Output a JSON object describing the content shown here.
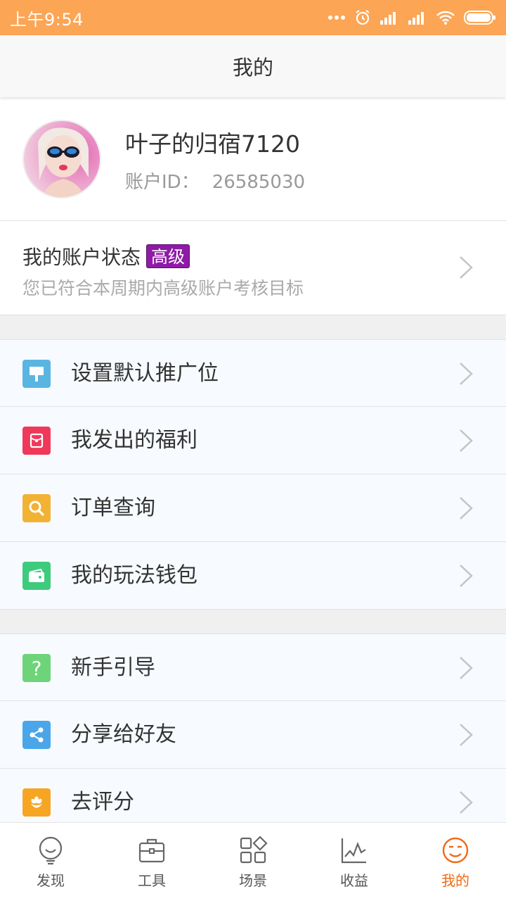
{
  "status_bar": {
    "time": "上午9:54"
  },
  "header": {
    "title": "我的"
  },
  "profile": {
    "name": "叶子的归宿7120",
    "id_label": "账户ID：",
    "id_value": "26585030"
  },
  "account_status": {
    "title": "我的账户状态",
    "badge": "高级",
    "subtitle": "您已符合本周期内高级账户考核目标"
  },
  "menu_group_1": [
    {
      "label": "设置默认推广位",
      "icon": "billboard-icon",
      "color": "#5ab5e0"
    },
    {
      "label": "我发出的福利",
      "icon": "red-envelope-icon",
      "color": "#f0385a"
    },
    {
      "label": "订单查询",
      "icon": "search-icon",
      "color": "#f2b233"
    },
    {
      "label": "我的玩法钱包",
      "icon": "wallet-icon",
      "color": "#3ecb7d"
    }
  ],
  "menu_group_2": [
    {
      "label": "新手引导",
      "icon": "question-icon",
      "color": "#6ed47a"
    },
    {
      "label": "分享给好友",
      "icon": "share-icon",
      "color": "#4aa6e8"
    },
    {
      "label": "去评分",
      "icon": "flower-icon",
      "color": "#f6a623"
    }
  ],
  "tabs": [
    {
      "label": "发现",
      "icon": "bulb-icon"
    },
    {
      "label": "工具",
      "icon": "briefcase-icon"
    },
    {
      "label": "场景",
      "icon": "grid-icon"
    },
    {
      "label": "收益",
      "icon": "chart-icon"
    },
    {
      "label": "我的",
      "icon": "smiley-icon",
      "active": true
    }
  ],
  "colors": {
    "status_bar": "#fca554",
    "accent": "#f06a14",
    "badge": "#8e1aa6"
  }
}
